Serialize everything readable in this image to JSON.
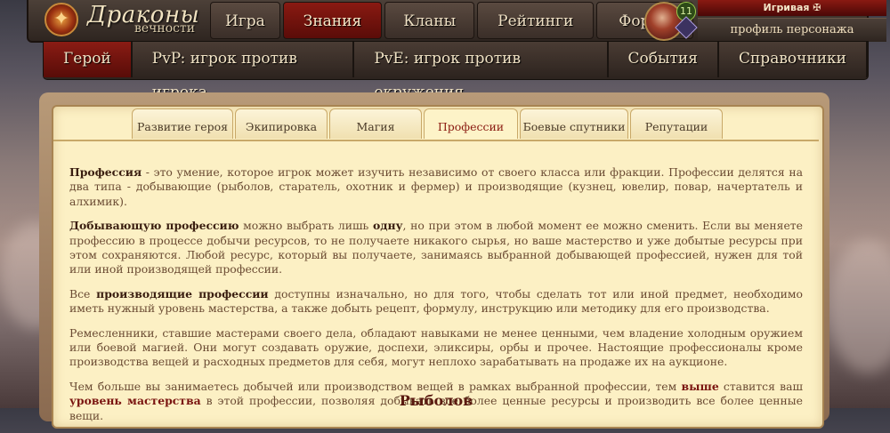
{
  "app": {
    "logo_title": "Драконы",
    "logo_subtitle": "вечности"
  },
  "topnav": {
    "items": [
      {
        "label": "Игра"
      },
      {
        "label": "Знания"
      },
      {
        "label": "Кланы"
      },
      {
        "label": "Рейтинги"
      },
      {
        "label": "Форум"
      }
    ],
    "active_index": 1
  },
  "profile": {
    "level": "11",
    "player_name": "Игривая ✠",
    "button_label": "профиль персонажа"
  },
  "subnav": {
    "items": [
      {
        "label": "Герой"
      },
      {
        "label": "PvP: игрок против игрока"
      },
      {
        "label": "PvE: игрок против окружения"
      },
      {
        "label": "События"
      },
      {
        "label": "Справочники"
      }
    ],
    "active_index": 0
  },
  "tabs": {
    "items": [
      {
        "label": "Развитие героя"
      },
      {
        "label": "Экипировка"
      },
      {
        "label": "Магия"
      },
      {
        "label": "Профессии"
      },
      {
        "label": "Боевые спутники"
      },
      {
        "label": "Репутации"
      }
    ],
    "active_index": 3
  },
  "content": {
    "p1": {
      "b1": "Профессия",
      "t1": " - это умение, которое игрок может изучить независимо от своего класса или фракции. Профессии делятся на два типа - добывающие (рыболов, старатель, охотник и фермер) и производящие (кузнец, ювелир, повар, начертатель и алхимик)."
    },
    "p2": {
      "b1": "Добывающую профессию",
      "t1": " можно выбрать лишь ",
      "b2": "одну",
      "t2": ", но при этом в любой момент ее можно сменить. Если вы меняете профессию в процессе добычи ресурсов, то не получаете никакого сырья, но ваше мастерство и уже добытые ресурсы при этом сохраняются. Любой ресурс, который вы получаете, занимаясь выбранной добывающей профессией, нужен для той или иной производящей профессии."
    },
    "p3": {
      "t0": "Все ",
      "b1": "производящие профессии",
      "t1": " доступны изначально, но для того, чтобы сделать тот или иной предмет, необходимо иметь нужный уровень мастерства, а также добыть рецепт, формулу, инструкцию или методику для его производства."
    },
    "p4": {
      "t1": "Ремесленники, ставшие мастерами своего дела, обладают навыками не менее ценными, чем владение холодным оружием или боевой магией. Они могут создавать оружие, доспехи, эликсиры, орбы и прочее. Настоящие профессионалы кроме производства вещей и расходных предметов для себя, могут неплохо зарабатывать на продаже их на аукционе."
    },
    "p5": {
      "t0": "Чем больше вы занимаетесь добычей или производством вещей в рамках выбранной профессии, тем ",
      "r1": "выше",
      "t1": " ставится ваш ",
      "r2": "уровень мастерства",
      "t2": " в этой профессии, позволяя добывать все более ценные ресурсы и производить все более ценные вещи."
    },
    "heading": "Рыболов"
  },
  "colors": {
    "accent_red": "#8a1a12",
    "panel_bg": "#fcf0c4",
    "text_brown": "#6a4a32"
  }
}
